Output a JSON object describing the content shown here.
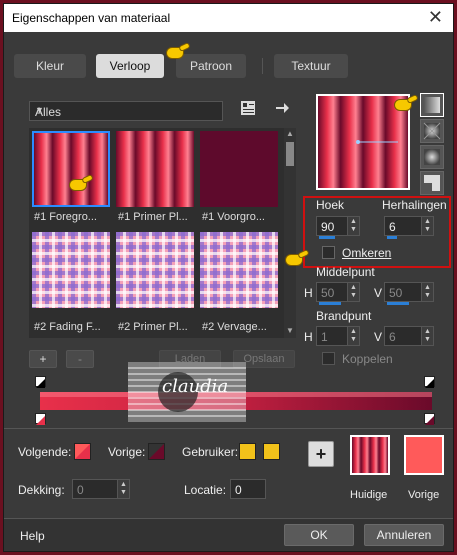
{
  "window": {
    "title": "Eigenschappen van materiaal",
    "close": "✕"
  },
  "tabs": [
    {
      "label": "Kleur",
      "active": false
    },
    {
      "label": "Verloop",
      "active": true
    },
    {
      "label": "Patroon",
      "active": false
    },
    {
      "label": "Textuur",
      "active": false
    }
  ],
  "library": {
    "category": "Alles",
    "items": [
      {
        "label": "#1 Foregro...",
        "selected": true,
        "style": "stripes-a"
      },
      {
        "label": "#1 Primer Pl...",
        "selected": false,
        "style": "stripes-b"
      },
      {
        "label": "#1 Voorgro...",
        "selected": false,
        "style": "solid"
      },
      {
        "label": "#2 Fading F...",
        "selected": false,
        "style": "plaid"
      },
      {
        "label": "#2 Primer Pl...",
        "selected": false,
        "style": "plaid"
      },
      {
        "label": "#2 Vervage...",
        "selected": false,
        "style": "plaid"
      }
    ]
  },
  "settings": {
    "hoek_label": "Hoek",
    "hoek_value": "90",
    "herhalingen_label": "Herhalingen",
    "herhalingen_value": "6",
    "omkeren_label": "Omkeren",
    "middelpunt_label": "Middelpunt",
    "h_label": "H",
    "v_label": "V",
    "middelpunt_h": "50",
    "middelpunt_v": "50",
    "brandpunt_label": "Brandpunt",
    "brandpunt_h": "1",
    "brandpunt_v": "6",
    "koppelen_label": "Koppelen"
  },
  "editor": {
    "add": "+",
    "remove": "-",
    "load": "Laden",
    "save": "Opslaan"
  },
  "bottom": {
    "volgende_label": "Volgende:",
    "vorige_label": "Vorige:",
    "gebruiker_label": "Gebruiker:",
    "dekking_label": "Dekking:",
    "dekking_value": "0",
    "locatie_label": "Locatie:",
    "locatie_value": "0",
    "huidige_label": "Huidige",
    "vorige_preview_label": "Vorige",
    "add_plus": "+"
  },
  "footer": {
    "help": "Help",
    "ok": "OK",
    "cancel": "Annuleren"
  },
  "watermark": {
    "text": "claudia"
  },
  "colors": {
    "foreground": "#e8304a",
    "dark": "#6a0a2a",
    "crimson": "#c22040",
    "user_yellow": "#f2c21a",
    "vorige_salmon": "#ff5a5a"
  }
}
